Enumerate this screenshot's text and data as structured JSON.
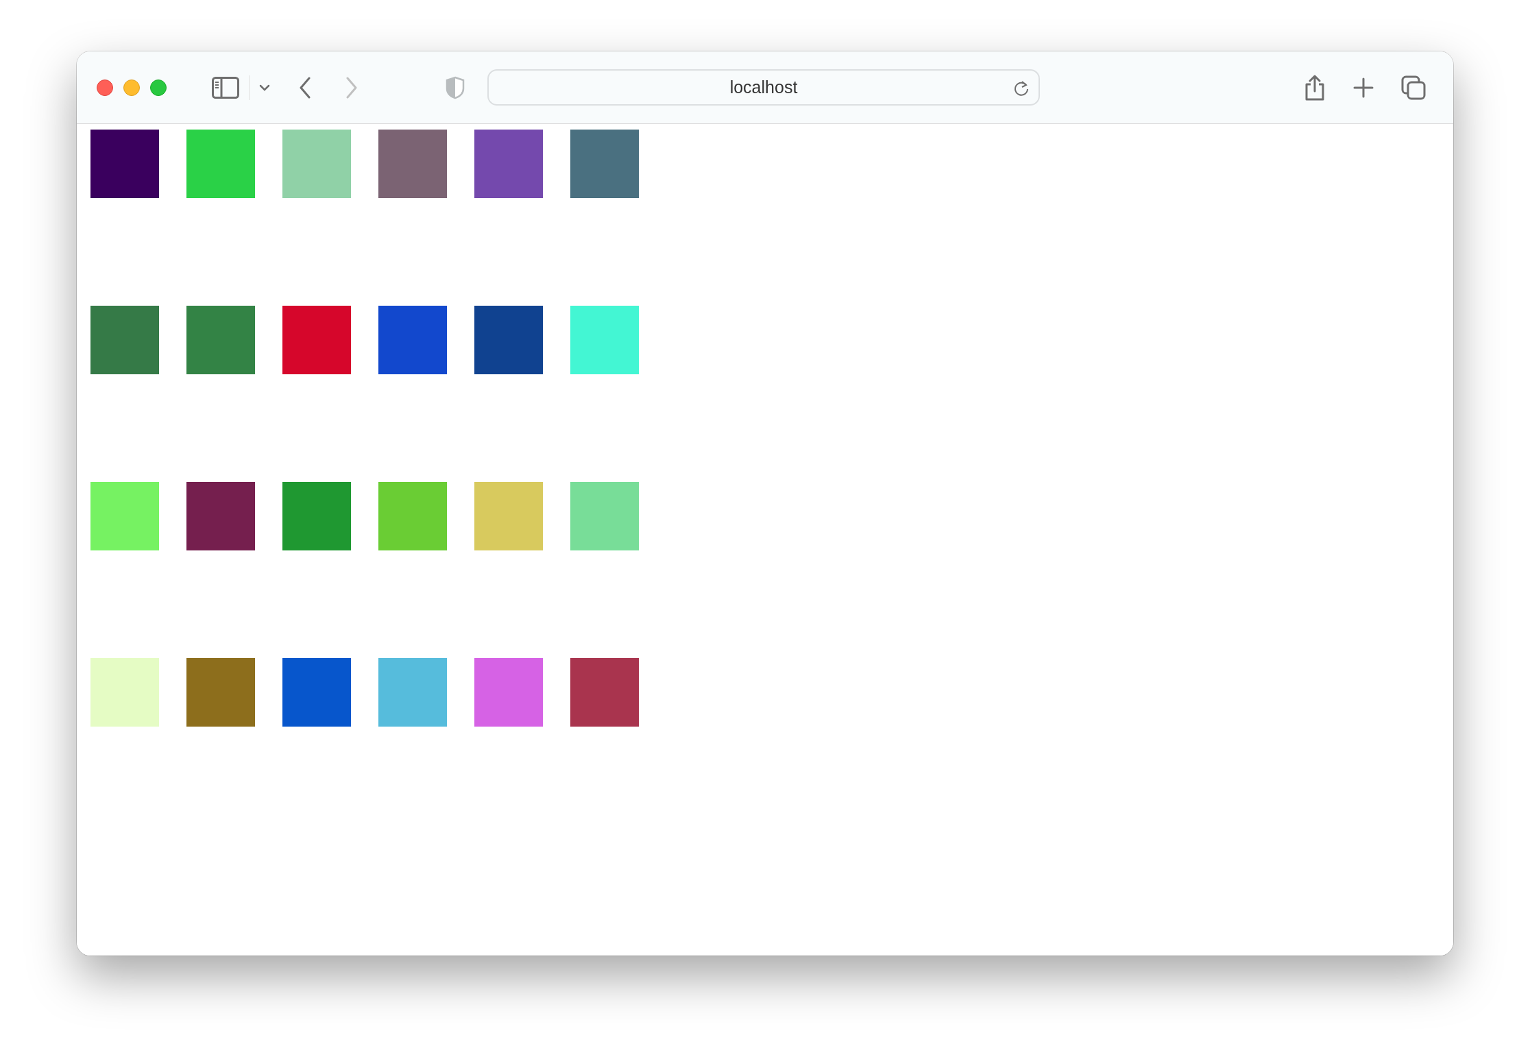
{
  "browser": {
    "address": "localhost"
  },
  "swatches": [
    {
      "color": "#3a005e"
    },
    {
      "color": "#2ad147"
    },
    {
      "color": "#90d1a7"
    },
    {
      "color": "#7b6373"
    },
    {
      "color": "#7449ad"
    },
    {
      "color": "#4a7080"
    },
    {
      "color": "#357a47"
    },
    {
      "color": "#338345"
    },
    {
      "color": "#d6062b"
    },
    {
      "color": "#1248cd"
    },
    {
      "color": "#104290"
    },
    {
      "color": "#43f6d3"
    },
    {
      "color": "#76f262"
    },
    {
      "color": "#751f4e"
    },
    {
      "color": "#1f9831"
    },
    {
      "color": "#6acd34"
    },
    {
      "color": "#d8ca5e"
    },
    {
      "color": "#78dd98"
    },
    {
      "color": "#e5fcc4"
    },
    {
      "color": "#8d6e1c"
    },
    {
      "color": "#0756cc"
    },
    {
      "color": "#56bcdc"
    },
    {
      "color": "#d662e5"
    },
    {
      "color": "#a9344e"
    }
  ]
}
